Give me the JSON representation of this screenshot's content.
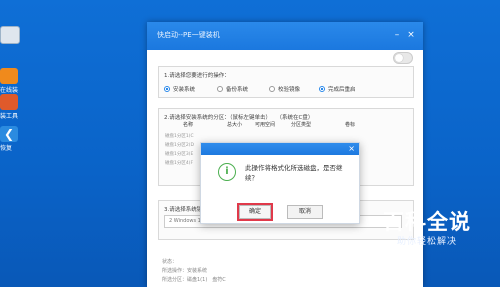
{
  "desktop": {
    "icons": [
      {
        "label": "",
        "color": "#d9d9d9",
        "icon": "computer-icon"
      },
      {
        "label": "在线装",
        "color": "#f08a1c",
        "icon": "installer-icon"
      },
      {
        "label": "装工具",
        "color": "#e05a2b",
        "icon": "toolbox-icon"
      },
      {
        "label": "恢复",
        "color": "#2b8be0",
        "icon": "back-arrow-icon"
      }
    ]
  },
  "window": {
    "title": "快启动--PE一键装机",
    "section1": {
      "label": "1.请选择您要进行的操作：",
      "options": [
        "安装系统",
        "备份系统",
        "校验镜像",
        "完成后重启"
      ],
      "selected": [
        0,
        3
      ]
    },
    "section2": {
      "label": "2.请选择安装系统的分区：（鼠标左键单击）　　（系统在C盘）",
      "headers": [
        "名称",
        "总大小",
        "可用空间",
        "分区类型",
        "卷标"
      ],
      "rows": [
        "磁盘1分区1(C",
        "磁盘1分区2(D",
        "磁盘1分区3(E",
        "磁盘1分区4(F"
      ]
    },
    "section3": {
      "label": "3.请选择系统镜",
      "dropdown_value": "2 Windows 10 家庭版"
    },
    "footer": [
      "状态：",
      "所选操作：安装系统",
      "所选分区：磁盘1(1)　盘符C"
    ]
  },
  "dialog": {
    "message": "此操作将格式化所选磁盘，是否继续？",
    "ok_label": "确定",
    "cancel_label": "取消"
  },
  "watermark": {
    "title": "百科全说",
    "subtitle": "助你轻松解决"
  }
}
